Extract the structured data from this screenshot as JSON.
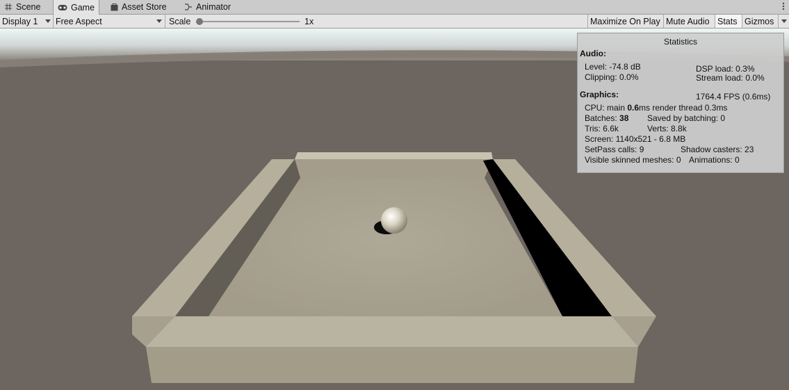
{
  "tabs": [
    {
      "label": "Scene",
      "icon": "grid-icon"
    },
    {
      "label": "Game",
      "icon": "gamepad-icon",
      "active": true
    },
    {
      "label": "Asset Store",
      "icon": "shopping-bag-icon"
    },
    {
      "label": "Animator",
      "icon": "animator-icon"
    }
  ],
  "toolbar": {
    "display_label": "Display 1",
    "aspect_label": "Free Aspect",
    "scale_label": "Scale",
    "scale_value": "1x",
    "scale_level": 0.0,
    "maximize_label": "Maximize On Play",
    "mute_label": "Mute Audio",
    "stats_label": "Stats",
    "gizmos_label": "Gizmos"
  },
  "stats": {
    "title": "Statistics",
    "audio_header": "Audio:",
    "level": "Level: -74.8 dB",
    "clipping": "Clipping: 0.0%",
    "dsp_load": "DSP load: 0.3%",
    "stream_load": "Stream load: 0.0%",
    "graphics_header": "Graphics:",
    "fps": "1764.4 FPS (0.6ms)",
    "cpu_prefix": "CPU: main ",
    "cpu_main": "0.6",
    "cpu_suffix": "ms  render thread 0.3ms",
    "batches_prefix": "Batches: ",
    "batches_value": "38",
    "saved_by_batching": "Saved by batching: 0",
    "tris": "Tris: 6.6k",
    "verts": "Verts: 8.8k",
    "screen": "Screen: 1140x521 - 6.8 MB",
    "setpass": "SetPass calls: 9",
    "shadow_casters": "Shadow casters: 23",
    "visible_skinned": "Visible skinned meshes: 0",
    "animations": "Animations: 0"
  },
  "colors": {
    "sky": "#f1f7f7",
    "ground": "#6c6560",
    "floor": "#a7a08f",
    "wall_top": "#c1bca8",
    "wall_shadow": "#000000"
  }
}
